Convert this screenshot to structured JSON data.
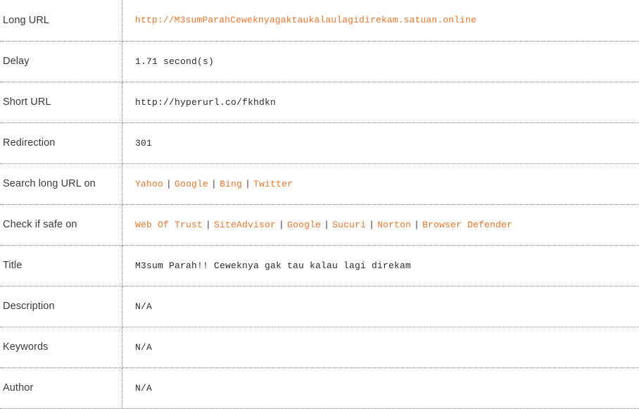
{
  "table": {
    "rows": [
      {
        "label": "Long URL",
        "type": "link",
        "value": "http://M3sumParahCeweknyagaktaukalaulagidirekam.satuan.online"
      },
      {
        "label": "Delay",
        "type": "text",
        "value": "1.71 second(s)"
      },
      {
        "label": "Short URL",
        "type": "text",
        "value": "http://hyperurl.co/fkhdkn"
      },
      {
        "label": "Redirection",
        "type": "text",
        "value": "301"
      },
      {
        "label": "Search long URL on",
        "type": "links",
        "links": [
          "Yahoo",
          "Google",
          "Bing",
          "Twitter"
        ],
        "separator": "|"
      },
      {
        "label": "Check if safe on",
        "type": "links",
        "links": [
          "Web Of Trust",
          "SiteAdvisor",
          "Google",
          "Sucuri",
          "Norton",
          "Browser Defender"
        ],
        "separator": "|"
      },
      {
        "label": "Title",
        "type": "text",
        "value": "M3sum Parah!! Ceweknya gak tau kalau lagi direkam"
      },
      {
        "label": "Description",
        "type": "text",
        "value": "N/A"
      },
      {
        "label": "Keywords",
        "type": "text",
        "value": "N/A"
      },
      {
        "label": "Author",
        "type": "text",
        "value": "N/A"
      }
    ]
  },
  "colors": {
    "link": "#e8762c",
    "label_text": "#3a3a3a",
    "value_text": "#2b2b2b",
    "divider": "#8a8a8a",
    "background": "#ffffff"
  }
}
